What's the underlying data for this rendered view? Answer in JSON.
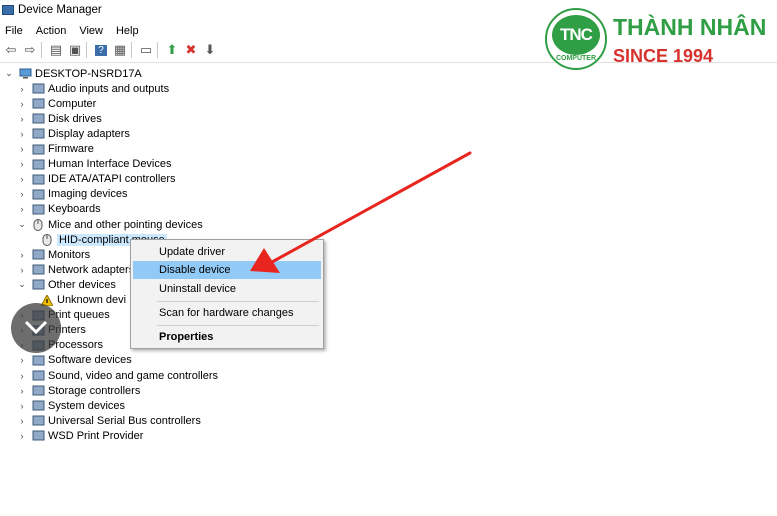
{
  "window": {
    "title": "Device Manager"
  },
  "menu": [
    "File",
    "Action",
    "View",
    "Help"
  ],
  "toolbar": {
    "buttons": [
      {
        "name": "back-icon",
        "glyph": "⇦"
      },
      {
        "name": "forward-icon",
        "glyph": "⇨"
      },
      {
        "name": "properties-sheet-icon",
        "glyph": "▤"
      },
      {
        "name": "show-hide-icon",
        "glyph": "▣"
      },
      {
        "name": "help-icon",
        "glyph": "?"
      },
      {
        "name": "view-resources-icon",
        "glyph": "▦"
      },
      {
        "name": "monitor-scan-icon",
        "glyph": "▭"
      },
      {
        "name": "update-driver-icon",
        "glyph": "⬆"
      },
      {
        "name": "uninstall-icon",
        "glyph": "✖"
      },
      {
        "name": "disable-icon",
        "glyph": "⬇"
      }
    ]
  },
  "tree": {
    "root": "DESKTOP-NSRD17A",
    "nodes": [
      {
        "label": "Audio inputs and outputs",
        "icon": "speaker-icon",
        "expanded": false
      },
      {
        "label": "Computer",
        "icon": "computer-icon",
        "expanded": false
      },
      {
        "label": "Disk drives",
        "icon": "disk-drive-icon",
        "expanded": false
      },
      {
        "label": "Display adapters",
        "icon": "display-adapter-icon",
        "expanded": false
      },
      {
        "label": "Firmware",
        "icon": "firmware-icon",
        "expanded": false
      },
      {
        "label": "Human Interface Devices",
        "icon": "hid-icon",
        "expanded": false
      },
      {
        "label": "IDE ATA/ATAPI controllers",
        "icon": "ide-controller-icon",
        "expanded": false
      },
      {
        "label": "Imaging devices",
        "icon": "camera-icon",
        "expanded": false
      },
      {
        "label": "Keyboards",
        "icon": "keyboard-icon",
        "expanded": false
      },
      {
        "label": "Mice and other pointing devices",
        "icon": "mouse-icon",
        "expanded": true
      },
      {
        "label": "HID-compliant mouse",
        "icon": "mouse-icon",
        "child": true,
        "selected": true
      },
      {
        "label": "Monitors",
        "icon": "monitor-icon",
        "expanded": false
      },
      {
        "label": "Network adapters",
        "icon": "network-icon",
        "expanded": false
      },
      {
        "label": "Other devices",
        "icon": "other-devices-icon",
        "expanded": true
      },
      {
        "label": "Unknown devi",
        "icon": "warning-icon",
        "child": true
      },
      {
        "label": "Print queues",
        "icon": "printer-icon",
        "expanded": false
      },
      {
        "label": "Printers",
        "icon": "printer-icon",
        "expanded": false
      },
      {
        "label": "Processors",
        "icon": "processor-icon",
        "expanded": false
      },
      {
        "label": "Software devices",
        "icon": "software-icon",
        "expanded": false
      },
      {
        "label": "Sound, video and game controllers",
        "icon": "speaker-icon",
        "expanded": false
      },
      {
        "label": "Storage controllers",
        "icon": "storage-icon",
        "expanded": false
      },
      {
        "label": "System devices",
        "icon": "system-icon",
        "expanded": false
      },
      {
        "label": "Universal Serial Bus controllers",
        "icon": "usb-icon",
        "expanded": false
      },
      {
        "label": "WSD Print Provider",
        "icon": "printer-icon",
        "expanded": false
      }
    ]
  },
  "context_menu": {
    "items": [
      {
        "label": "Update driver"
      },
      {
        "label": "Disable device",
        "active": true
      },
      {
        "label": "Uninstall device"
      },
      {
        "label": "Scan for hardware changes"
      },
      {
        "label": "Properties",
        "bold": true
      }
    ]
  },
  "logo": {
    "mark": "TNC",
    "sub": "COMPUTER",
    "name": "THÀNH NHÂN",
    "since": "SINCE 1994",
    "green": "#2f9e44",
    "red": "#d6322e"
  },
  "annotation": {
    "arrow_color": "#e8261f"
  }
}
